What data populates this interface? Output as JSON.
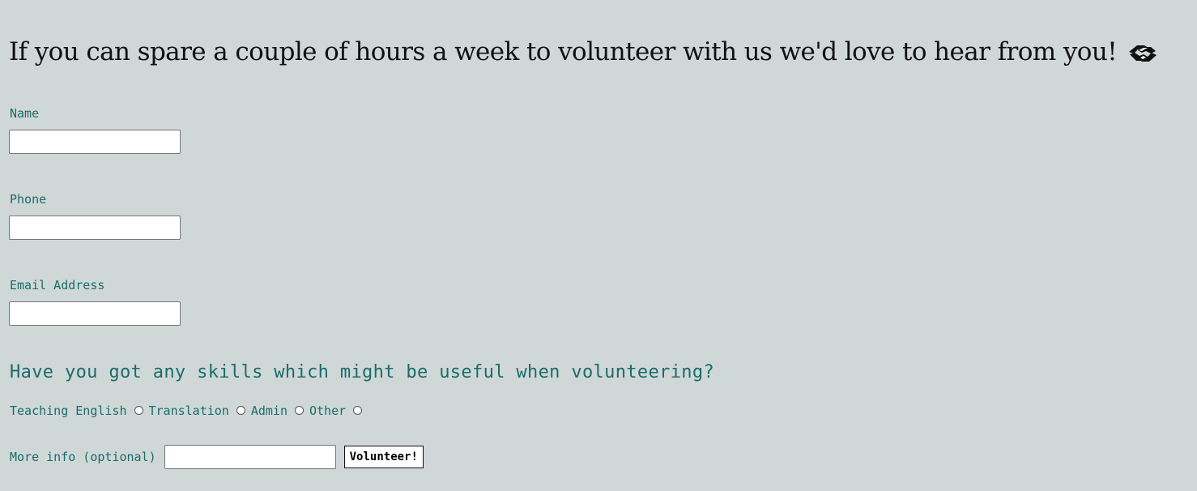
{
  "heading": {
    "text": "If you can spare a couple of hours a week to volunteer with us we'd love to hear from you!",
    "icon": "handshake-icon"
  },
  "form": {
    "name_label": "Name",
    "name_value": "",
    "phone_label": "Phone",
    "phone_value": "",
    "email_label": "Email Address",
    "email_value": "",
    "skills_heading": "Have you got any skills which might be useful when volunteering?",
    "skills": [
      {
        "label": "Teaching English",
        "checked": false
      },
      {
        "label": "Translation",
        "checked": false
      },
      {
        "label": "Admin",
        "checked": false
      },
      {
        "label": "Other",
        "checked": false
      }
    ],
    "more_info_label": "More info (optional)",
    "more_info_value": "",
    "submit_label": "Volunteer!"
  },
  "colors": {
    "background": "#cfd8d7",
    "label": "#1c6b6b",
    "heading": "#111111"
  }
}
